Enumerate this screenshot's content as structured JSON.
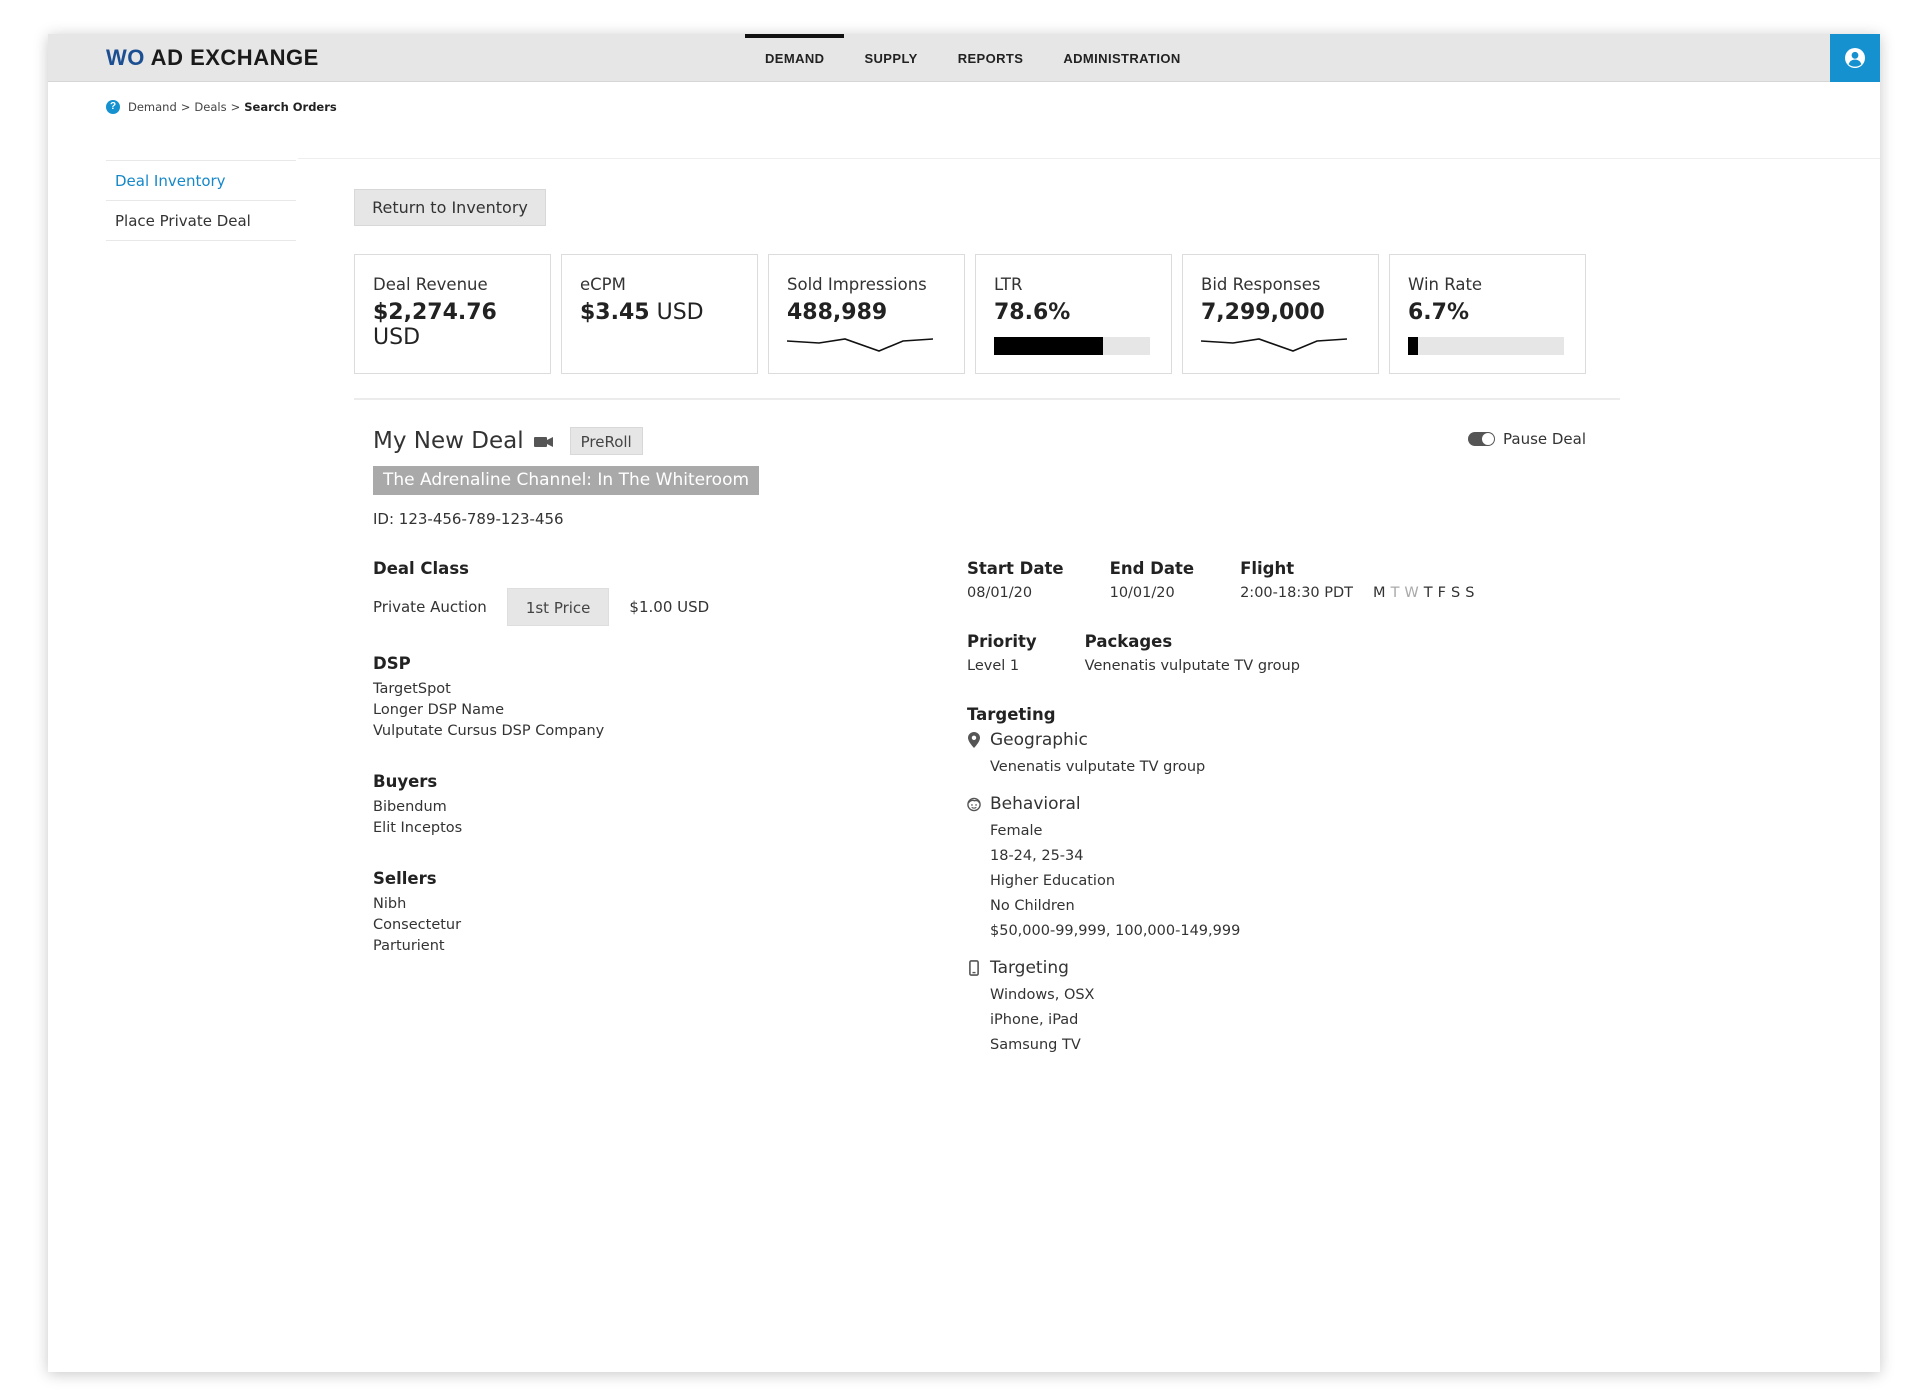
{
  "app": {
    "logo_prefix": "WO",
    "logo_suffix": " AD EXCHANGE"
  },
  "nav": {
    "items": [
      {
        "label": "DEMAND",
        "active": true
      },
      {
        "label": "SUPPLY",
        "active": false
      },
      {
        "label": "REPORTS",
        "active": false
      },
      {
        "label": "ADMINISTRATION",
        "active": false
      }
    ]
  },
  "breadcrumb": {
    "help": "?",
    "items": [
      "Demand",
      "Deals",
      "Search Orders"
    ],
    "separator": ">"
  },
  "sidebar": {
    "items": [
      {
        "label": "Deal Inventory",
        "active": true
      },
      {
        "label": "Place Private Deal",
        "active": false
      }
    ]
  },
  "return_button": "Return to Inventory",
  "metrics": [
    {
      "label": "Deal Revenue",
      "value": "$2,274.76",
      "unit": " USD",
      "viz": "none"
    },
    {
      "label": "eCPM",
      "value": "$3.45",
      "unit": " USD",
      "viz": "none"
    },
    {
      "label": "Sold Impressions",
      "value": "488,989",
      "unit": "",
      "viz": "sparkline"
    },
    {
      "label": "LTR",
      "value": "78.6%",
      "unit": "",
      "viz": "bar",
      "fraction": 0.7
    },
    {
      "label": "Bid Responses",
      "value": "7,299,000",
      "unit": "",
      "viz": "sparkline"
    },
    {
      "label": "Win Rate",
      "value": "6.7%",
      "unit": "",
      "viz": "bar",
      "fraction": 0.067
    }
  ],
  "deal": {
    "title": "My New Deal",
    "tag": "PreRoll",
    "channel": "The Adrenaline Channel: In The Whiteroom",
    "id": "ID: 123-456-789-123-456",
    "pause_label": "Pause Deal",
    "deal_class": {
      "title": "Deal Class",
      "type": "Private Auction",
      "price_type": "1st Price",
      "price": "$1.00 USD"
    },
    "dsp": {
      "title": "DSP",
      "items": [
        "TargetSpot",
        "Longer DSP Name",
        "Vulputate Cursus DSP Company"
      ]
    },
    "buyers": {
      "title": "Buyers",
      "items": [
        "Bibendum",
        "Elit Inceptos"
      ]
    },
    "sellers": {
      "title": "Sellers",
      "items": [
        "Nibh",
        "Consectetur",
        "Parturient"
      ]
    },
    "start_date": {
      "title": "Start Date",
      "value": "08/01/20"
    },
    "end_date": {
      "title": "End Date",
      "value": "10/01/20"
    },
    "flight": {
      "title": "Flight",
      "value": "2:00-18:30 PDT",
      "days": [
        {
          "d": "M",
          "on": true
        },
        {
          "d": "T",
          "on": false
        },
        {
          "d": "W",
          "on": false
        },
        {
          "d": "T",
          "on": true
        },
        {
          "d": "F",
          "on": true
        },
        {
          "d": "S",
          "on": true
        },
        {
          "d": "S",
          "on": true
        }
      ]
    },
    "priority": {
      "title": "Priority",
      "value": "Level 1"
    },
    "packages": {
      "title": "Packages",
      "value": "Venenatis vulputate TV group"
    },
    "targeting": {
      "title": "Targeting",
      "groups": [
        {
          "icon": "location-pin-icon",
          "label": "Geographic",
          "items": [
            "Venenatis vulputate TV group"
          ]
        },
        {
          "icon": "face-icon",
          "label": "Behavioral",
          "items": [
            "Female",
            "18-24, 25-34",
            "Higher Education",
            "No Children",
            "$50,000-99,999, 100,000-149,999"
          ]
        },
        {
          "icon": "mobile-device-icon",
          "label": "Targeting",
          "items": [
            "Windows, OSX",
            "iPhone, iPad",
            "Samsung TV"
          ]
        }
      ]
    }
  },
  "colors": {
    "accent": "#1591d0",
    "link": "#1688c9",
    "logo_blue": "#1c4f91"
  }
}
